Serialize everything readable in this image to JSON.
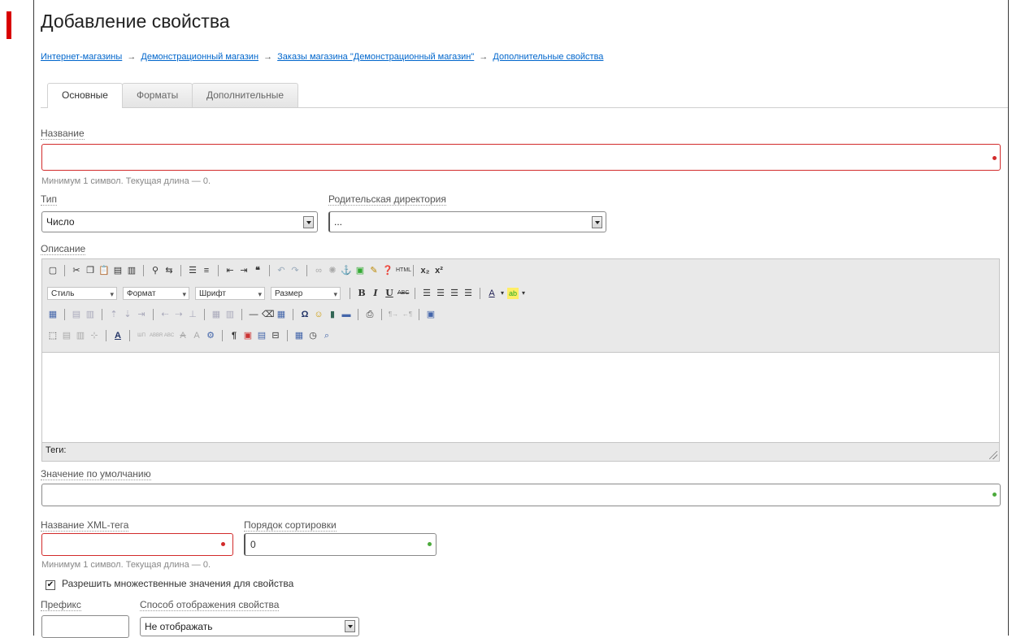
{
  "page": {
    "title": "Добавление свойства"
  },
  "breadcrumb": {
    "items": [
      "Интернет-магазины",
      "Демонстрационный магазин",
      "Заказы магазина \"Демонстрационный магазин\"",
      "Дополнительные свойства"
    ],
    "separator": "→"
  },
  "tabs": [
    {
      "label": "Основные",
      "active": true
    },
    {
      "label": "Форматы",
      "active": false
    },
    {
      "label": "Дополнительные",
      "active": false
    }
  ],
  "form": {
    "name": {
      "label": "Название",
      "value": "",
      "hint": "Минимум 1 символ. Текущая длина — 0."
    },
    "type": {
      "label": "Тип",
      "value": "Число"
    },
    "parent_dir": {
      "label": "Родительская директория",
      "value": "..."
    },
    "description": {
      "label": "Описание",
      "toolbar_combos": [
        "Стиль",
        "Формат",
        "Шрифт",
        "Размер"
      ],
      "tags_label": "Теги:"
    },
    "default_value": {
      "label": "Значение по умолчанию",
      "value": ""
    },
    "xml_tag": {
      "label": "Название XML-тега",
      "value": "",
      "hint": "Минимум 1 символ. Текущая длина — 0."
    },
    "sort_order": {
      "label": "Порядок сортировки",
      "value": "0"
    },
    "multiple": {
      "label": "Разрешить множественные значения для свойства",
      "checked": true,
      "mark": "✔"
    },
    "prefix": {
      "label": "Префикс",
      "value": ""
    },
    "display_mode": {
      "label": "Способ отображения свойства",
      "value": "Не отображать"
    }
  },
  "colors": {
    "accent_marker": "#d80000",
    "error_border": "#d22b2b",
    "ok_dot": "#4caa3c",
    "link": "#0066cc"
  }
}
